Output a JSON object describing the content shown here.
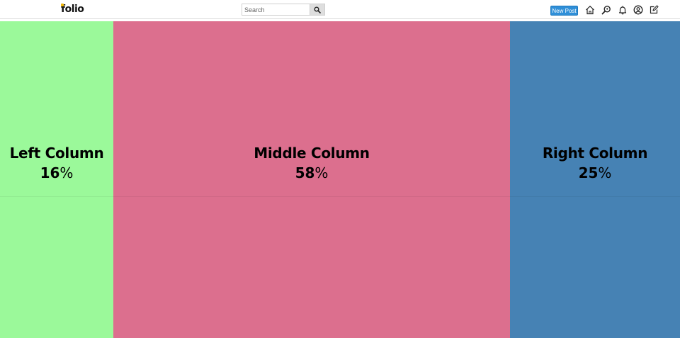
{
  "header": {
    "logo_text": "folio",
    "search": {
      "placeholder": "Search",
      "value": ""
    },
    "new_post_label": "New Post",
    "icons": [
      "home-icon",
      "explore-icon",
      "bell-icon",
      "profile-icon",
      "edit-icon"
    ]
  },
  "columns": [
    {
      "title": "Left Column",
      "percent": "16",
      "color": "#9bf99a"
    },
    {
      "title": "Middle Column",
      "percent": "58",
      "color": "#dc6f8e"
    },
    {
      "title": "Right Column",
      "percent": "25",
      "color": "#4682b4"
    }
  ],
  "percent_sign": "%"
}
